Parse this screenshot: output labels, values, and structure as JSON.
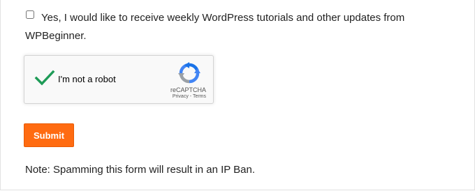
{
  "consent": {
    "checked": false,
    "label_line1": "Yes, I would like to receive weekly WordPress tutorials and other updates from",
    "label_line2": "WPBeginner."
  },
  "recaptcha": {
    "label": "I'm not a robot",
    "brand": "reCAPTCHA",
    "privacy": "Privacy",
    "separator": " - ",
    "terms": "Terms",
    "checkmark_icon": "green-checkmark-icon",
    "logo_icon": "recaptcha-logo-icon",
    "colors": {
      "check": "#1e9b57",
      "logo_blue": "#1a73e8",
      "logo_gray": "#9aa0a6"
    }
  },
  "form": {
    "submit_label": "Submit",
    "note": "Note: Spamming this form will result in an IP Ban."
  },
  "colors": {
    "button_bg": "#ff6b11",
    "button_text": "#ffffff"
  }
}
